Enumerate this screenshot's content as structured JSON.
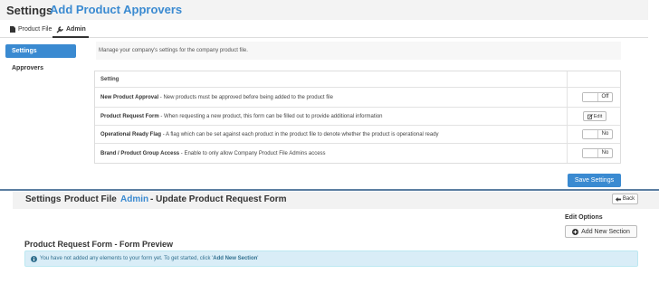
{
  "header": {
    "title": "Settings",
    "subtitle": "Add Product Approvers"
  },
  "tabs": [
    {
      "label": "Product File"
    },
    {
      "label": "Admin"
    }
  ],
  "sidebar": {
    "items": [
      {
        "label": "Settings"
      },
      {
        "label": "Approvers"
      }
    ]
  },
  "intro_text": "Manage your company's settings for the company product file.",
  "table": {
    "header": "Setting",
    "rows": [
      {
        "name": "New Product Approval",
        "desc": " - New products must be approved before being added to the product file",
        "control": "Off"
      },
      {
        "name": "Product Request Form",
        "desc": " - When requesting a new product, this form can be filled out to provide additional information",
        "control": "Edit"
      },
      {
        "name": "Operational Ready Flag",
        "desc": " - A flag which can be set against each product in the product file to denote whether the product is operational ready",
        "control": "No"
      },
      {
        "name": "Brand / Product Group Access",
        "desc": " - Enable to only allow Company Product File Admins access",
        "control": "No"
      }
    ]
  },
  "save_label": "Save Settings",
  "second": {
    "crumb1": "Settings",
    "crumb2": "Product File",
    "crumb3": "Admin",
    "crumb4": "- Update Product Request Form",
    "back_label": "Back",
    "edit_options": "Edit Options",
    "add_section": "Add New Section",
    "preview_title": "Product Request Form - Form Preview",
    "info_prefix": "You have not added any elements to your form yet. To get started, click '",
    "info_link": "Add New Section",
    "info_suffix": "'"
  },
  "colors": {
    "accent": "#3a8ad1",
    "info_bg": "#d9edf7",
    "info_text": "#31708f"
  }
}
